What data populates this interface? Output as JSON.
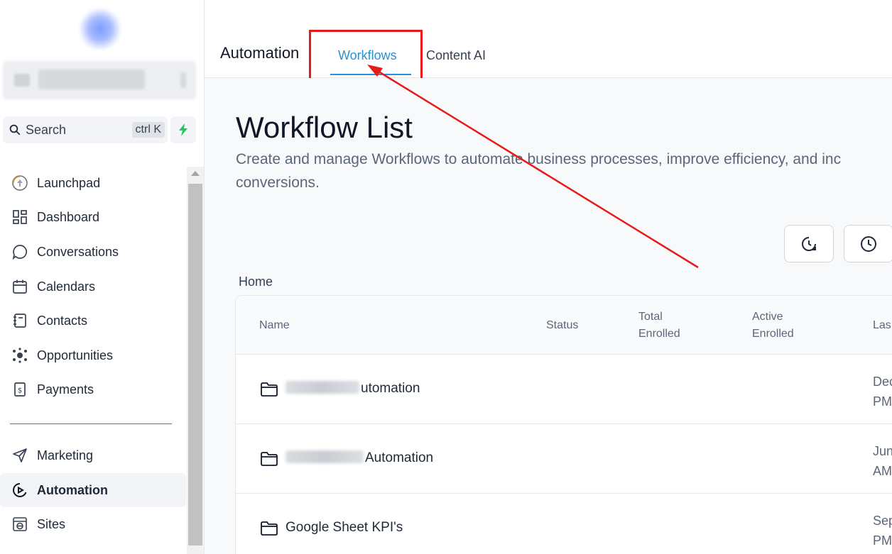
{
  "sidebar": {
    "search": {
      "label": "Search",
      "shortcut": "ctrl K"
    },
    "items": [
      {
        "label": "Launchpad",
        "icon": "launchpad-icon"
      },
      {
        "label": "Dashboard",
        "icon": "dashboard-icon"
      },
      {
        "label": "Conversations",
        "icon": "chat-bubble-icon"
      },
      {
        "label": "Calendars",
        "icon": "calendar-icon"
      },
      {
        "label": "Contacts",
        "icon": "contacts-book-icon"
      },
      {
        "label": "Opportunities",
        "icon": "opportunities-icon"
      },
      {
        "label": "Payments",
        "icon": "payments-receipt-icon"
      },
      {
        "label": "Marketing",
        "icon": "send-icon"
      },
      {
        "label": "Automation",
        "icon": "automation-icon",
        "active": true
      },
      {
        "label": "Sites",
        "icon": "sites-icon"
      }
    ]
  },
  "header": {
    "app_title": "Automation",
    "tabs": [
      {
        "label": "Workflows",
        "active": true
      },
      {
        "label": "Content AI"
      }
    ],
    "accent_color": "#2a8fd3",
    "annotation_color": "#e81a1a"
  },
  "main": {
    "title": "Workflow List",
    "description": "Create and manage Workflows to automate business processes, improve efficiency, and inc\nconversions.",
    "breadcrumb": "Home",
    "table": {
      "columns": {
        "name": "Name",
        "status": "Status",
        "total_enrolled": "Total\nEnrolled",
        "active_enrolled": "Active\nEnrolled",
        "last": "Las"
      },
      "rows": [
        {
          "name_visible": "utomation",
          "date": "Dec\nPM"
        },
        {
          "name_visible": "Automation",
          "date": "Jun\nAM"
        },
        {
          "name_visible": "Google Sheet KPI's",
          "date": "Sep\nPM"
        }
      ]
    }
  }
}
